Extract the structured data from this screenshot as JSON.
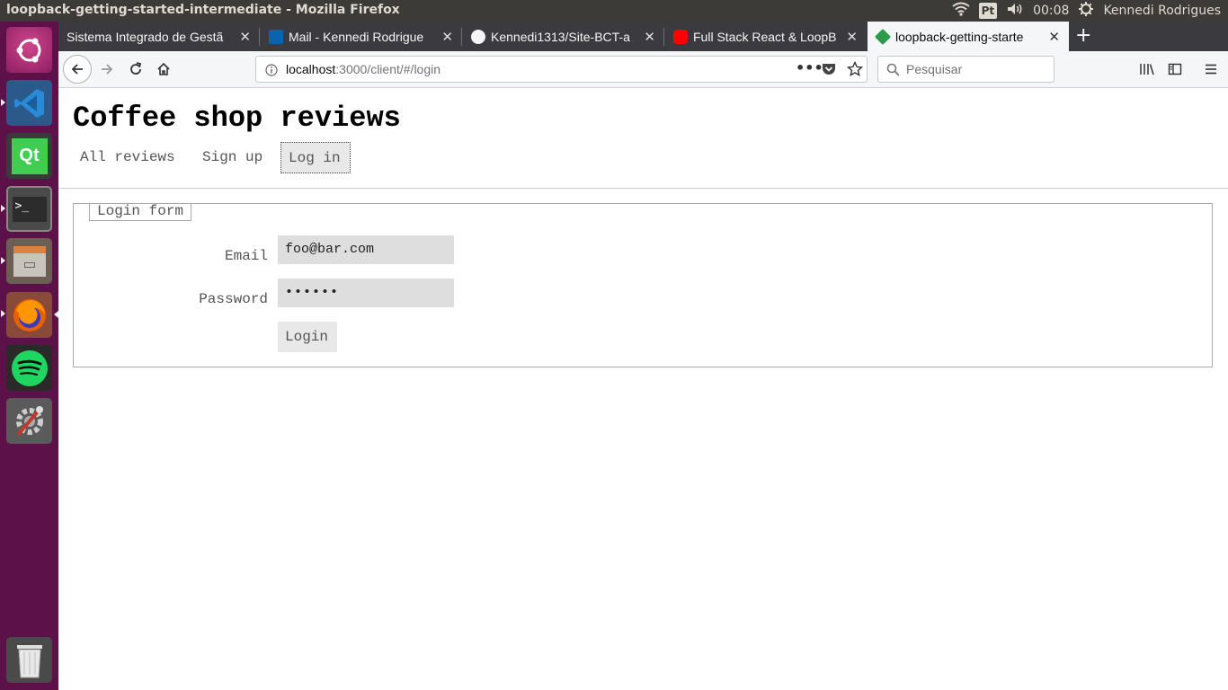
{
  "system": {
    "window_title": "loopback-getting-started-intermediate - Mozilla Firefox",
    "keyboard_layout": "Pt",
    "clock": "00:08",
    "user": "Kennedi Rodrigues"
  },
  "launcher": {
    "items": [
      "dash",
      "vscode",
      "qt-creator",
      "terminal",
      "files",
      "firefox",
      "spotify",
      "system-settings",
      "trash"
    ]
  },
  "tabs": [
    {
      "label": "Sistema Integrado de Gestã"
    },
    {
      "label": "Mail - Kennedi Rodrigues"
    },
    {
      "label": "Kennedi1313/Site-BCT-a"
    },
    {
      "label": "Full Stack React & LoopB"
    },
    {
      "label": "loopback-getting-starte"
    }
  ],
  "navbar": {
    "url_host": "localhost",
    "url_path": ":3000/client/#/login",
    "search_placeholder": "Pesquisar"
  },
  "page": {
    "title": "Coffee shop reviews",
    "nav": [
      "All reviews",
      "Sign up",
      "Log in"
    ],
    "form": {
      "legend": "Login form",
      "email_label": "Email",
      "email_value": "foo@bar.com",
      "password_label": "Password",
      "password_value": "••••••",
      "submit_label": "Login"
    }
  },
  "colors": {
    "launcher_bg": "#5c1249",
    "topbar_bg": "#3c3b37",
    "tabstrip_bg": "#3b3a3f"
  }
}
